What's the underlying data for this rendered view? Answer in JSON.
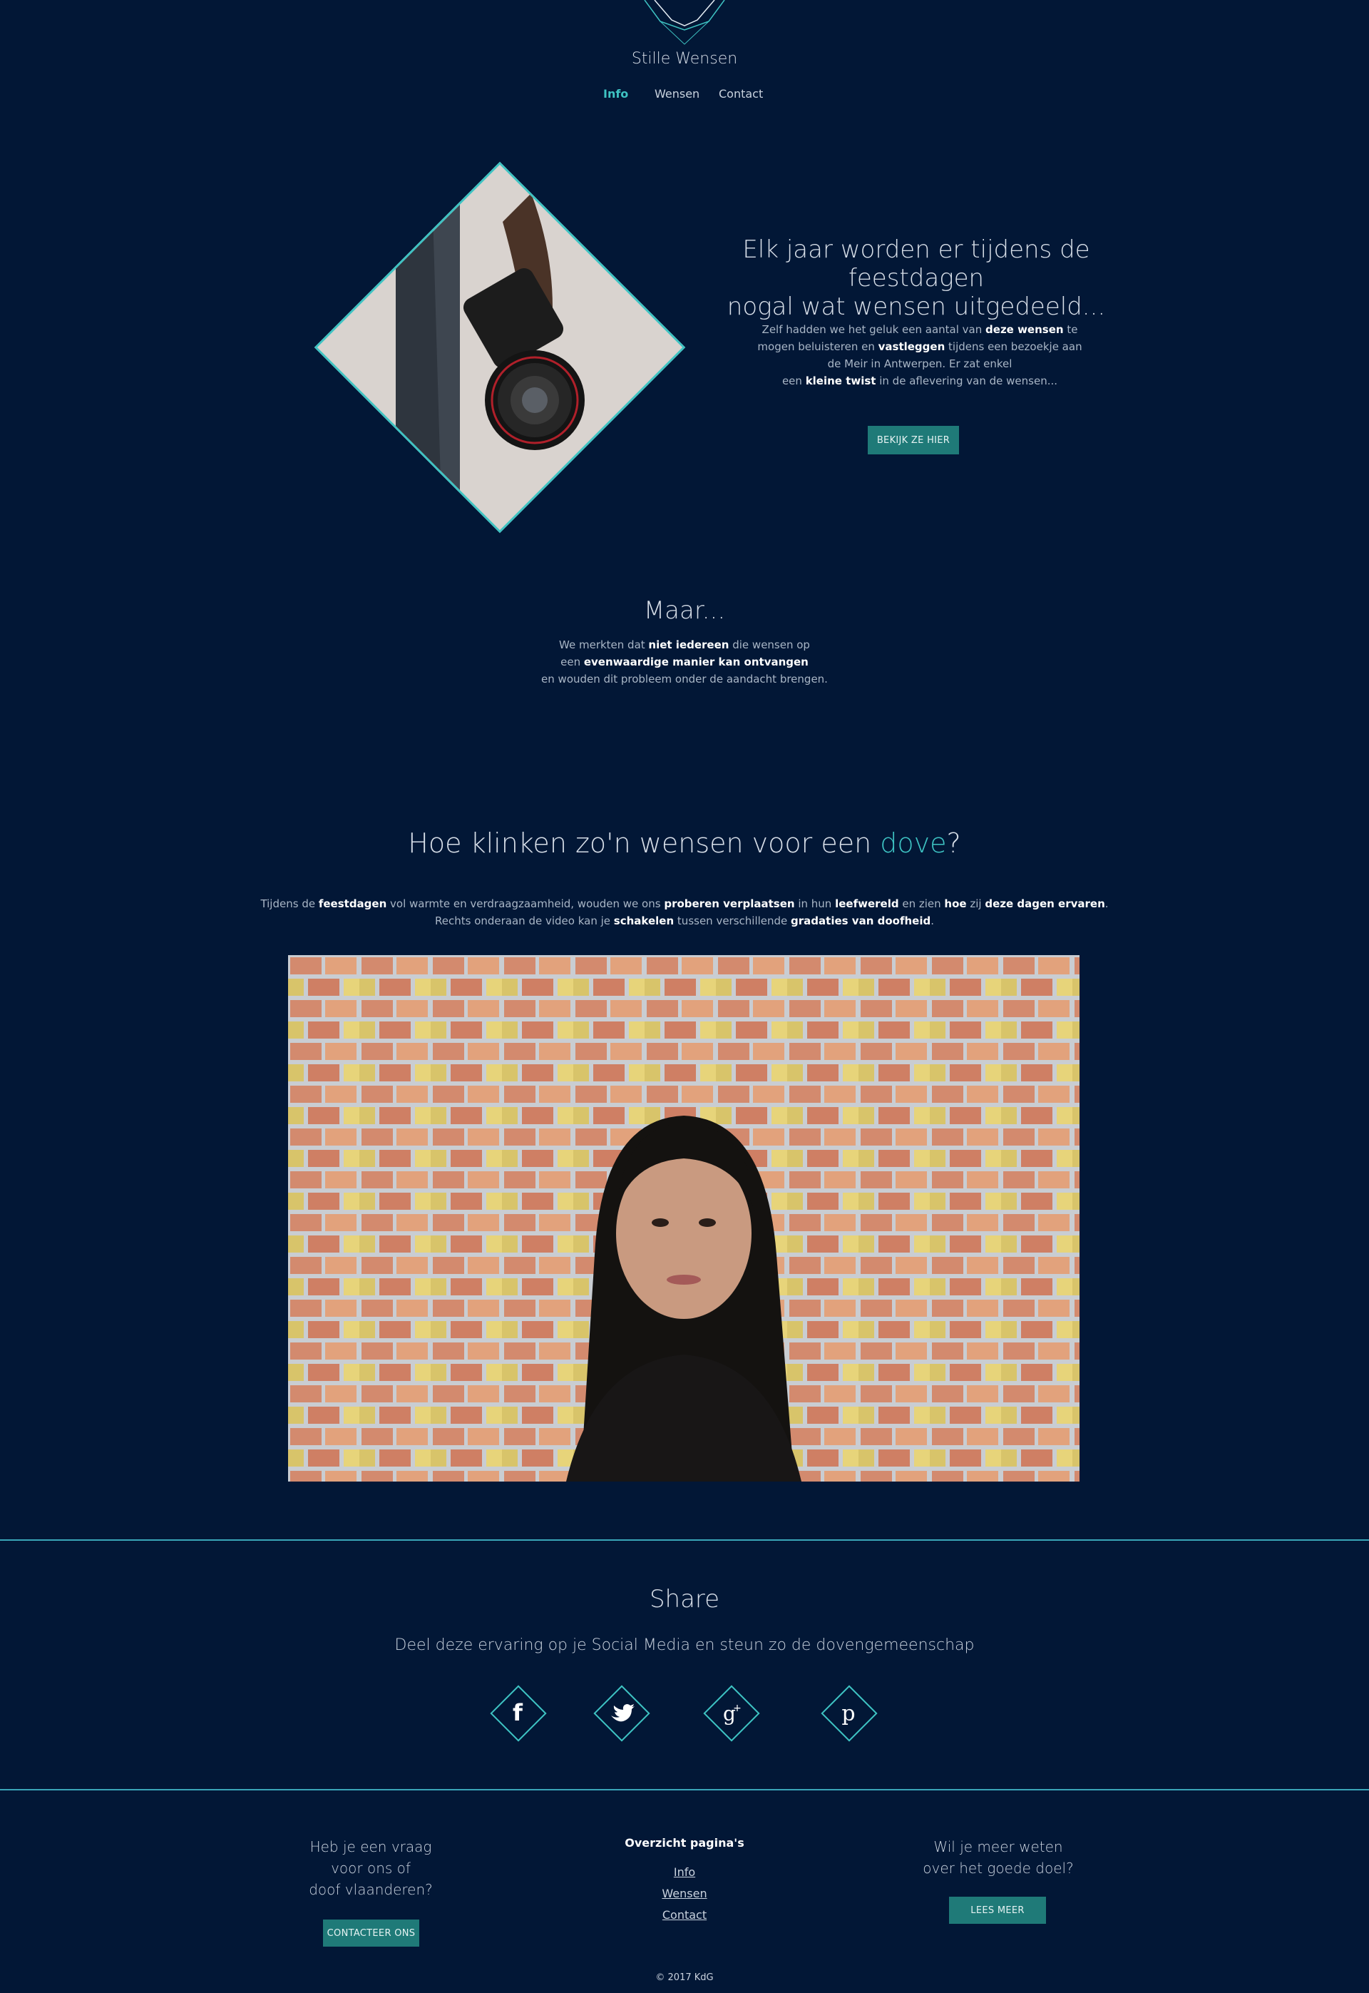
{
  "header": {
    "brand": "Stille Wensen",
    "nav": [
      {
        "label": "Info",
        "active": true
      },
      {
        "label": "Wensen",
        "active": false
      },
      {
        "label": "Contact",
        "active": false
      }
    ]
  },
  "hero": {
    "title_line1": "Elk jaar worden er tijdens de feestdagen",
    "title_line2": "nogal wat wensen uitgedeeld...",
    "text": {
      "p1": "Zelf hadden we het geluk een aantal van ",
      "b1": "deze wensen",
      "p2": " te mogen beluisteren en ",
      "b2": "vastleggen",
      "p3": " tijdens een bezoekje aan de Meir in Antwerpen. Er zat enkel",
      "p4": "een ",
      "b3": "kleine twist",
      "p5": " in de aflevering van de wensen..."
    },
    "button": "BEKIJK ZE HIER"
  },
  "maar": {
    "title": "Maar...",
    "l1a": "We merkten dat ",
    "l1b": "niet iedereen",
    "l1c": " die wensen op",
    "l2a": "een ",
    "l2b": "evenwaardige manier kan ontvangen",
    "l3": "en wouden dit probleem onder de aandacht brengen."
  },
  "dove": {
    "title_pre": "Hoe klinken zo'n wensen voor een ",
    "title_accent": "dove",
    "title_post": "?",
    "l1": [
      "Tijdens de ",
      "feestdagen",
      " vol warmte en verdraagzaamheid, wouden we ons ",
      "proberen verplaatsen",
      " in hun ",
      "leefwereld",
      " en zien ",
      "hoe",
      " zij ",
      "deze dagen ervaren",
      "."
    ],
    "l2": [
      "Rechts onderaan de video kan je ",
      "schakelen",
      " tussen verschillende ",
      "gradaties van doofheid",
      "."
    ]
  },
  "share": {
    "title": "Share",
    "text": "Deel deze ervaring op je Social Media en steun zo de dovengemeenschap",
    "icons": [
      "facebook-icon",
      "twitter-icon",
      "google-plus-icon",
      "pinterest-icon"
    ]
  },
  "footer": {
    "question_l1": "Heb je een vraag",
    "question_l2": "voor ons of",
    "question_l3": "doof vlaanderen?",
    "contact_button": "CONTACTEER ONS",
    "overview_title": "Overzicht pagina's",
    "links": [
      "Info",
      "Wensen",
      "Contact"
    ],
    "more_l1": "Wil je meer weten",
    "more_l2": "over het goede doel?",
    "more_button": "LEES MEER",
    "copyright": "© 2017 KdG"
  },
  "colors": {
    "background": "#021736",
    "accent": "#3ec3c3",
    "button": "#1f7a78"
  }
}
